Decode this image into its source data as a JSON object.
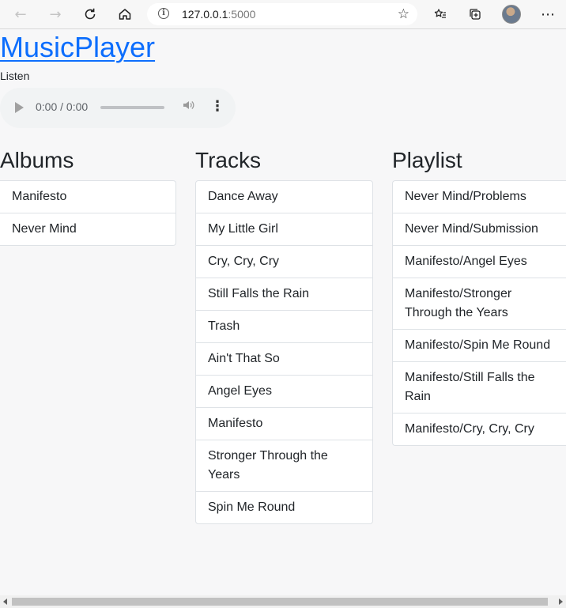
{
  "browser": {
    "url_host": "127.0.0.1",
    "url_port": ":5000",
    "icons": {
      "back": "arrow-left-icon",
      "forward": "arrow-right-icon",
      "refresh": "refresh-icon",
      "home": "home-icon",
      "info": "info-icon",
      "add_favorite": "star-plus-icon",
      "favorites": "favorites-icon",
      "collections": "collections-icon",
      "more": "more-horizontal-icon"
    }
  },
  "app": {
    "title": "MusicPlayer",
    "listen_label": "Listen",
    "link_color": "#0d6efd"
  },
  "audio": {
    "time": "0:00 / 0:00",
    "progress": 0
  },
  "albums": {
    "heading": "Albums",
    "items": [
      "Manifesto",
      "Never Mind"
    ]
  },
  "tracks": {
    "heading": "Tracks",
    "items": [
      "Dance Away",
      "My Little Girl",
      "Cry, Cry, Cry",
      "Still Falls the Rain",
      "Trash",
      "Ain't That So",
      "Angel Eyes",
      "Manifesto",
      "Stronger Through the Years",
      "Spin Me Round"
    ]
  },
  "playlist": {
    "heading": "Playlist",
    "items": [
      "Never Mind/Problems",
      "Never Mind/Submission",
      "Manifesto/Angel Eyes",
      "Manifesto/Stronger Through the Years",
      "Manifesto/Spin Me Round",
      "Manifesto/Still Falls the Rain",
      "Manifesto/Cry, Cry, Cry"
    ]
  }
}
